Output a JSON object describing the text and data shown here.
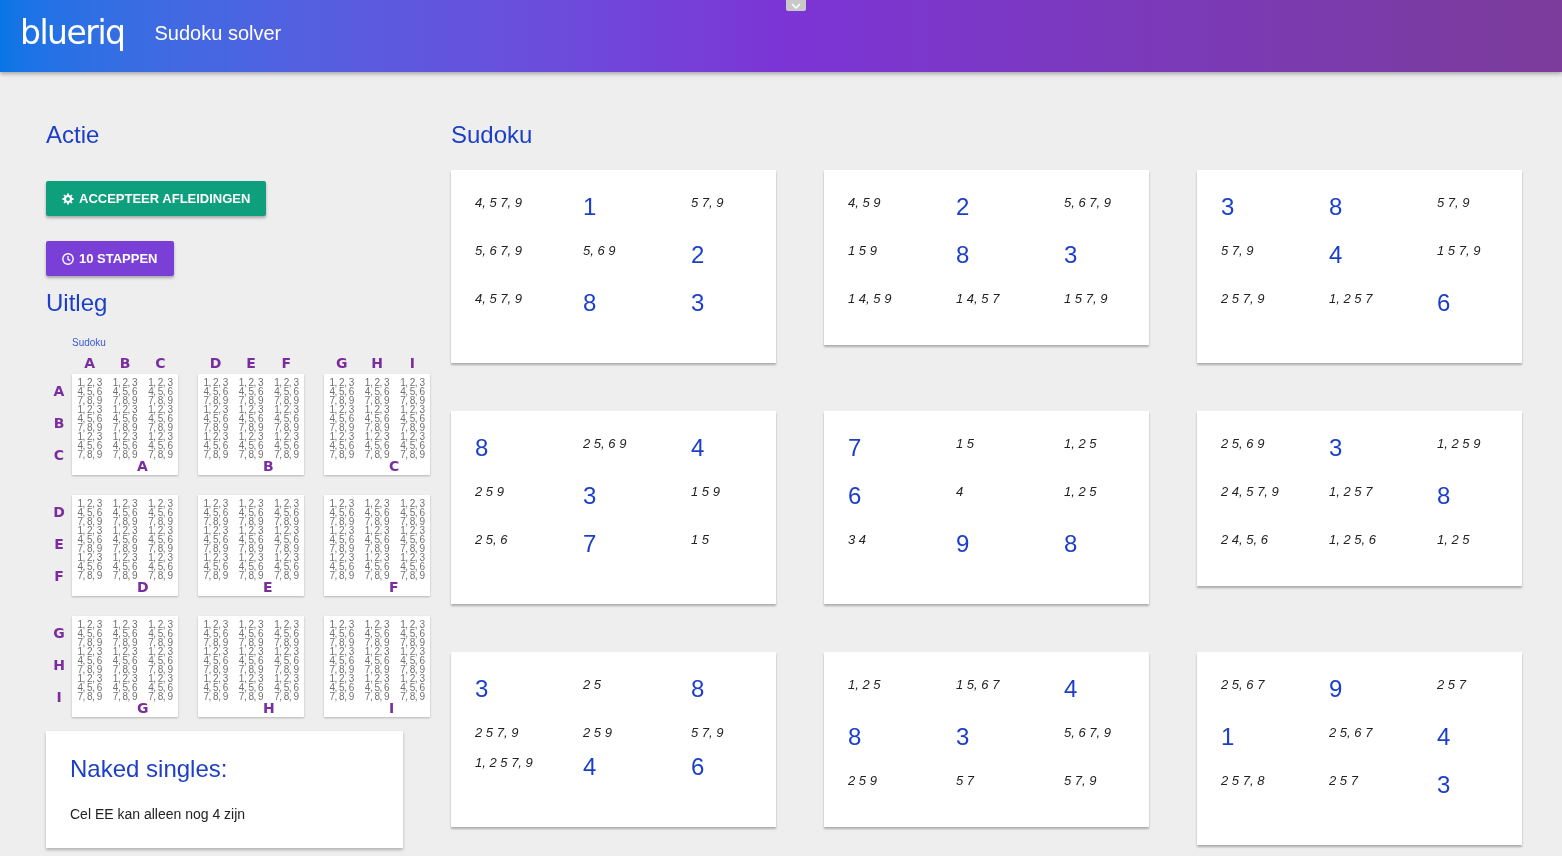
{
  "header": {
    "logo": "blueriq",
    "title": "Sudoku solver",
    "panel_toggle": {
      "expanded": false
    }
  },
  "actions": {
    "title": "Actie",
    "buttons": [
      {
        "kind": "accept",
        "label": "ACCEPTEER AFLEIDINGEN"
      },
      {
        "kind": "steps",
        "label": "10 STAPPEN"
      }
    ]
  },
  "explanation": {
    "title": "Uitleg",
    "diagram": {
      "title": "Sudoku",
      "column_labels": [
        "A",
        "B",
        "C",
        "D",
        "E",
        "F",
        "G",
        "H",
        "I"
      ],
      "row_labels": [
        "A",
        "B",
        "C",
        "D",
        "E",
        "F",
        "G",
        "H",
        "I"
      ],
      "boxes": [
        {
          "label": "A",
          "cells": [
            "1, 2, 3\n4, 5, 6\n7, 8, 9",
            "1, 2, 3\n4, 5, 6\n7, 8, 9",
            "1, 2, 3\n4, 5, 6\n7, 8, 9",
            "1, 2, 3\n4, 5, 6\n7, 8, 9",
            "1, 2, 3\n4, 5, 6\n7, 8, 9",
            "1, 2, 3\n4, 5, 6\n7, 8, 9",
            "1, 2, 3\n4, 5, 6\n7, 8, 9",
            "1, 2, 3\n4, 5, 6\n7, 8, 9",
            "1, 2, 3\n4, 5, 6\n7, 8, 9"
          ]
        },
        {
          "label": "B",
          "cells": [
            "1, 2, 3\n4, 5, 6\n7, 8, 9",
            "1, 2, 3\n4, 5, 6\n7, 8, 9",
            "1, 2, 3\n4, 5, 6\n7, 8, 9",
            "1, 2, 3\n4, 5, 6\n7, 8, 9",
            "1, 2, 3\n4, 5, 6\n7, 8, 9",
            "1, 2, 3\n4, 5, 6\n7, 8, 9",
            "1, 2, 3\n4, 5, 6\n7, 8, 9",
            "1, 2, 3\n4, 5, 6\n7, 8, 9",
            "1, 2, 3\n4, 5, 6\n7, 8, 9"
          ]
        },
        {
          "label": "C",
          "cells": [
            "1, 2, 3\n4, 5, 6\n7, 8, 9",
            "1, 2, 3\n4, 5, 6\n7, 8, 9",
            "1, 2, 3\n4, 5, 6\n7, 8, 9",
            "1, 2, 3\n4, 5, 6\n7, 8, 9",
            "1, 2, 3\n4, 5, 6\n7, 8, 9",
            "1, 2, 3\n4, 5, 6\n7, 8, 9",
            "1, 2, 3\n4, 5, 6\n7, 8, 9",
            "1, 2, 3\n4, 5, 6\n7, 8, 9",
            "1, 2, 3\n4, 5, 6\n7, 8, 9"
          ]
        },
        {
          "label": "D",
          "cells": [
            "1, 2, 3\n4, 5, 6\n7, 8, 9",
            "1, 2, 3\n4, 5, 6\n7, 8, 9",
            "1, 2, 3\n4, 5, 6\n7, 8, 9",
            "1, 2, 3\n4, 5, 6\n7, 8, 9",
            "1, 2, 3\n4, 5, 6\n7, 8, 9",
            "1, 2, 3\n4, 5, 6\n7, 8, 9",
            "1, 2, 3\n4, 5, 6\n7, 8, 9",
            "1, 2, 3\n4, 5, 6\n7, 8, 9",
            "1, 2, 3\n4, 5, 6\n7, 8, 9"
          ]
        },
        {
          "label": "E",
          "cells": [
            "1, 2, 3\n4, 5, 6\n7, 8, 9",
            "1, 2, 3\n4, 5, 6\n7, 8, 9",
            "1, 2, 3\n4, 5, 6\n7, 8, 9",
            "1, 2, 3\n4, 5, 6\n7, 8, 9",
            "1, 2, 3\n4, 5, 6\n7, 8, 9",
            "1, 2, 3\n4, 5, 6\n7, 8, 9",
            "1, 2, 3\n4, 5, 6\n7, 8, 9",
            "1, 2, 3\n4, 5, 6\n7, 8, 9",
            "1, 2, 3\n4, 5, 6\n7, 8, 9"
          ]
        },
        {
          "label": "F",
          "cells": [
            "1, 2, 3\n4, 5, 6\n7, 8, 9",
            "1, 2, 3\n4, 5, 6\n7, 8, 9",
            "1, 2, 3\n4, 5, 6\n7, 8, 9",
            "1, 2, 3\n4, 5, 6\n7, 8, 9",
            "1, 2, 3\n4, 5, 6\n7, 8, 9",
            "1, 2, 3\n4, 5, 6\n7, 8, 9",
            "1, 2, 3\n4, 5, 6\n7, 8, 9",
            "1, 2, 3\n4, 5, 6\n7, 8, 9",
            "1, 2, 3\n4, 5, 6\n7, 8, 9"
          ]
        },
        {
          "label": "G",
          "cells": [
            "1, 2, 3\n4, 5, 6\n7, 8, 9",
            "1, 2, 3\n4, 5, 6\n7, 8, 9",
            "1, 2, 3\n4, 5, 6\n7, 8, 9",
            "1, 2, 3\n4, 5, 6\n7, 8, 9",
            "1, 2, 3\n4, 5, 6\n7, 8, 9",
            "1, 2, 3\n4, 5, 6\n7, 8, 9",
            "1, 2, 3\n4, 5, 6\n7, 8, 9",
            "1, 2, 3\n4, 5, 6\n7, 8, 9",
            "1, 2, 3\n4, 5, 6\n7, 8, 9"
          ]
        },
        {
          "label": "H",
          "cells": [
            "1, 2, 3\n4, 5, 6\n7, 8, 9",
            "1, 2, 3\n4, 5, 6\n7, 8, 9",
            "1, 2, 3\n4, 5, 6\n7, 8, 9",
            "1, 2, 3\n4, 5, 6\n7, 8, 9",
            "1, 2, 3\n4, 5, 6\n7, 8, 9",
            "1, 2, 3\n4, 5, 6\n7, 8, 9",
            "1, 2, 3\n4, 5, 6\n7, 8, 9",
            "1, 2, 3\n4, 5, 6\n7, 8, 9",
            "1, 2, 3\n4, 5, 6\n7, 8, 9"
          ]
        },
        {
          "label": "I",
          "cells": [
            "1, 2, 3\n4, 5, 6\n7, 8, 9",
            "1, 2, 3\n4, 5, 6\n7, 8, 9",
            "1, 2, 3\n4, 5, 6\n7, 8, 9",
            "1, 2, 3\n4, 5, 6\n7, 8, 9",
            "1, 2, 3\n4, 5, 6\n7, 8, 9",
            "1, 2, 3\n4, 5, 6\n7, 8, 9",
            "1, 2, 3\n4, 5, 6\n7, 8, 9",
            "1, 2, 3\n4, 5, 6\n7, 8, 9",
            "1, 2, 3\n4, 5, 6\n7, 8, 9"
          ]
        }
      ]
    }
  },
  "naked_singles": {
    "title": "Naked singles:",
    "text": "Cel EE kan alleen nog 4 zijn"
  },
  "sudoku": {
    "title": "Sudoku",
    "boxes": [
      {
        "cells": [
          {
            "kind": "candidates",
            "text": "4, 5 7, 9"
          },
          {
            "kind": "given",
            "text": "1"
          },
          {
            "kind": "candidates",
            "text": "5 7, 9"
          },
          {
            "kind": "candidates",
            "text": "5, 6 7, 9"
          },
          {
            "kind": "candidates",
            "text": "5, 6 9"
          },
          {
            "kind": "given",
            "text": "2"
          },
          {
            "kind": "candidates",
            "text": "4, 5 7, 9"
          },
          {
            "kind": "given",
            "text": "8"
          },
          {
            "kind": "given",
            "text": "3"
          }
        ]
      },
      {
        "cells": [
          {
            "kind": "candidates",
            "text": "4, 5 9"
          },
          {
            "kind": "given",
            "text": "2"
          },
          {
            "kind": "candidates",
            "text": "5, 6 7, 9"
          },
          {
            "kind": "candidates",
            "text": "1 5 9"
          },
          {
            "kind": "given",
            "text": "8"
          },
          {
            "kind": "given",
            "text": "3"
          },
          {
            "kind": "candidates",
            "text": "1 4, 5 9"
          },
          {
            "kind": "candidates",
            "text": "1 4, 5 7"
          },
          {
            "kind": "candidates",
            "text": "1 5 7, 9"
          }
        ]
      },
      {
        "cells": [
          {
            "kind": "given",
            "text": "3"
          },
          {
            "kind": "given",
            "text": "8"
          },
          {
            "kind": "candidates",
            "text": "5 7, 9"
          },
          {
            "kind": "candidates",
            "text": "5 7, 9"
          },
          {
            "kind": "given",
            "text": "4"
          },
          {
            "kind": "candidates",
            "text": "1 5 7, 9"
          },
          {
            "kind": "candidates",
            "text": "2 5 7, 9"
          },
          {
            "kind": "candidates",
            "text": "1, 2 5 7"
          },
          {
            "kind": "given",
            "text": "6"
          }
        ]
      },
      {
        "cells": [
          {
            "kind": "given",
            "text": "8"
          },
          {
            "kind": "candidates",
            "text": "2 5, 6 9"
          },
          {
            "kind": "given",
            "text": "4"
          },
          {
            "kind": "candidates",
            "text": "2 5 9"
          },
          {
            "kind": "given",
            "text": "3"
          },
          {
            "kind": "candidates",
            "text": "1 5 9"
          },
          {
            "kind": "candidates",
            "text": "2 5, 6"
          },
          {
            "kind": "given",
            "text": "7"
          },
          {
            "kind": "candidates",
            "text": "1 5"
          }
        ]
      },
      {
        "cells": [
          {
            "kind": "given",
            "text": "7"
          },
          {
            "kind": "candidates",
            "text": "1 5"
          },
          {
            "kind": "candidates",
            "text": "1, 2 5"
          },
          {
            "kind": "given",
            "text": "6"
          },
          {
            "kind": "candidates",
            "text": "4"
          },
          {
            "kind": "candidates",
            "text": "1, 2 5"
          },
          {
            "kind": "candidates",
            "text": "3 4"
          },
          {
            "kind": "given",
            "text": "9"
          },
          {
            "kind": "given",
            "text": "8"
          }
        ]
      },
      {
        "cells": [
          {
            "kind": "candidates",
            "text": "2 5, 6 9"
          },
          {
            "kind": "given",
            "text": "3"
          },
          {
            "kind": "candidates",
            "text": "1, 2 5 9"
          },
          {
            "kind": "candidates",
            "text": "2 4, 5 7, 9"
          },
          {
            "kind": "candidates",
            "text": "1, 2 5 7"
          },
          {
            "kind": "given",
            "text": "8"
          },
          {
            "kind": "candidates",
            "text": "2 4, 5, 6"
          },
          {
            "kind": "candidates",
            "text": "1, 2 5, 6"
          },
          {
            "kind": "candidates",
            "text": "1, 2 5"
          }
        ]
      },
      {
        "cells": [
          {
            "kind": "given",
            "text": "3"
          },
          {
            "kind": "candidates",
            "text": "2 5"
          },
          {
            "kind": "given",
            "text": "8"
          },
          {
            "kind": "candidates",
            "text": "2 5 7, 9"
          },
          {
            "kind": "candidates",
            "text": "2 5 9"
          },
          {
            "kind": "candidates",
            "text": "5 7, 9"
          },
          {
            "kind": "candidates",
            "text": "1, 2 5 7, 9"
          },
          {
            "kind": "given",
            "text": "4"
          },
          {
            "kind": "given",
            "text": "6"
          }
        ]
      },
      {
        "cells": [
          {
            "kind": "candidates",
            "text": "1, 2 5"
          },
          {
            "kind": "candidates",
            "text": "1 5, 6 7"
          },
          {
            "kind": "given",
            "text": "4"
          },
          {
            "kind": "given",
            "text": "8"
          },
          {
            "kind": "given",
            "text": "3"
          },
          {
            "kind": "candidates",
            "text": "5, 6 7, 9"
          },
          {
            "kind": "candidates",
            "text": "2 5 9"
          },
          {
            "kind": "candidates",
            "text": "5 7"
          },
          {
            "kind": "candidates",
            "text": "5 7, 9"
          }
        ]
      },
      {
        "cells": [
          {
            "kind": "candidates",
            "text": "2 5, 6 7"
          },
          {
            "kind": "given",
            "text": "9"
          },
          {
            "kind": "candidates",
            "text": "2 5 7"
          },
          {
            "kind": "given",
            "text": "1"
          },
          {
            "kind": "candidates",
            "text": "2 5, 6 7"
          },
          {
            "kind": "given",
            "text": "4"
          },
          {
            "kind": "candidates",
            "text": "2 5 7, 8"
          },
          {
            "kind": "candidates",
            "text": "2 5 7"
          },
          {
            "kind": "given",
            "text": "3"
          }
        ]
      }
    ]
  }
}
